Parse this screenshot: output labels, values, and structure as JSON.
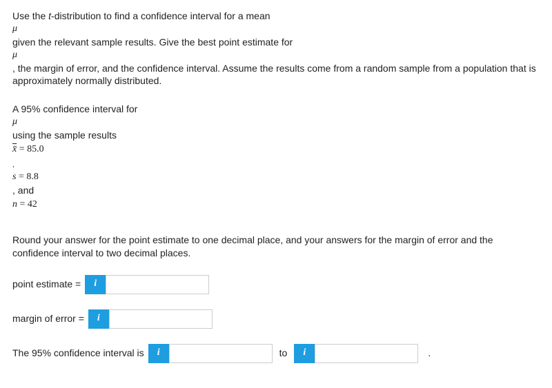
{
  "intro": {
    "line1_a": "Use the ",
    "line1_t": "t",
    "line1_b": "-distribution to find a confidence interval for a mean",
    "mu1": "μ",
    "line2": "given the relevant sample results. Give the best point estimate for",
    "mu2": "μ",
    "line3": ", the margin of error, and the confidence interval. Assume the results come from a random sample from a population that is approximately normally distributed."
  },
  "problem": {
    "ci_text": "A 95% confidence interval for",
    "mu3": "μ",
    "using_text": "using the sample results",
    "xbar_sym": "x̄",
    "xbar_eq": " = 85.0",
    "comma": ",",
    "s_sym": "s",
    "s_eq": " = 8.8",
    "and_text": ", and",
    "n_sym": "n",
    "n_eq": " = 42"
  },
  "instructions": "Round your answer for the point estimate to one decimal place, and your answers for the margin of error and the confidence interval to two decimal places.",
  "labels": {
    "point_estimate": "point estimate = ",
    "margin_error": "margin of error = ",
    "ci_prefix": "The 95% confidence interval is ",
    "to": " to ",
    "period": " ."
  },
  "info_glyph": "i"
}
